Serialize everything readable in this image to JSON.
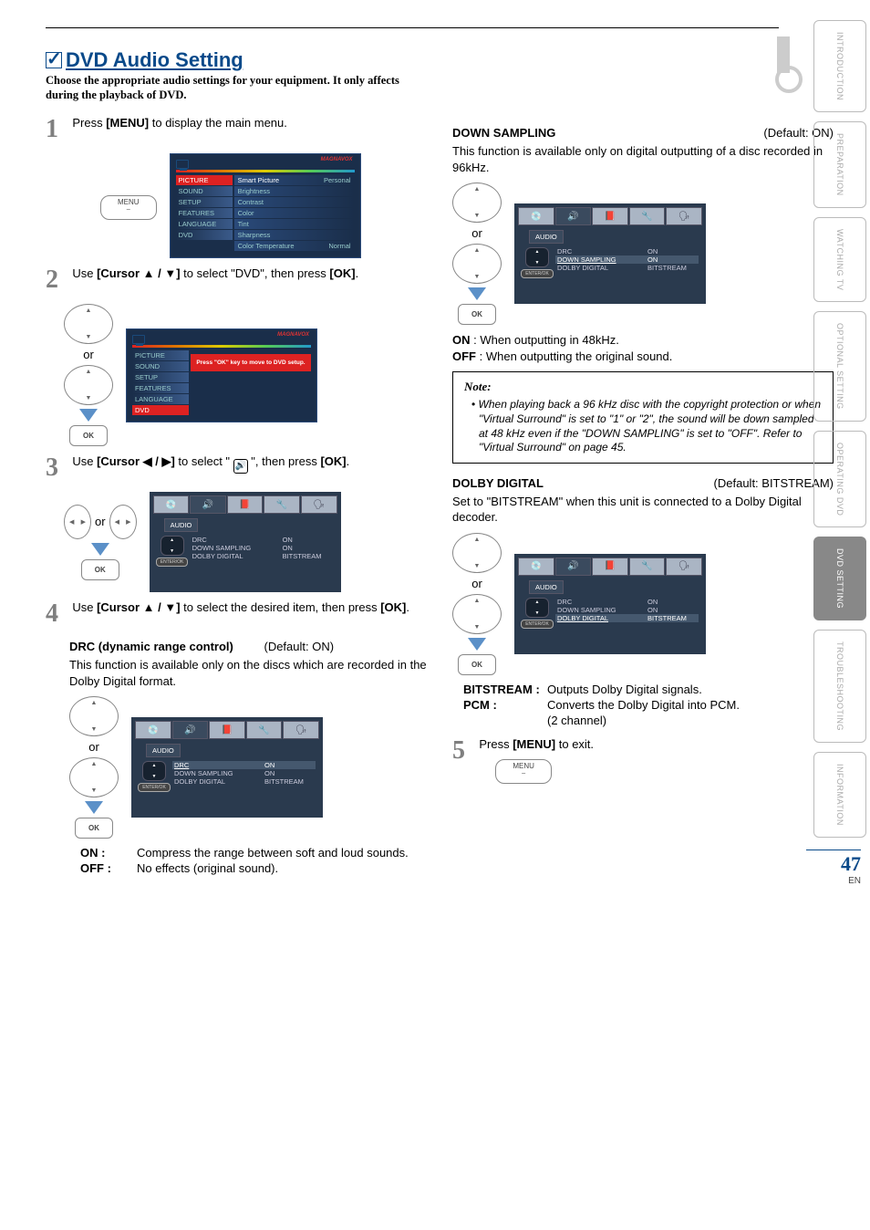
{
  "page_number": "47",
  "page_lang": "EN",
  "title": "DVD Audio Setting",
  "subtitle": "Choose the appropriate audio settings for your equipment. It only affects during the playback of DVD.",
  "sidetabs": [
    "INTRODUCTION",
    "PREPARATION",
    "WATCHING  TV",
    "OPTIONAL  SETTING",
    "OPERATING  DVD",
    "DVD  SETTING",
    "TROUBLESHOOTING",
    "INFORMATION"
  ],
  "active_sidetab": 5,
  "labels": {
    "menu": "MENU",
    "ok": "OK",
    "enter_ok": "ENTER/OK",
    "or": "or",
    "audio_label": "AUDIO",
    "brand": "MAGNAVOX"
  },
  "steps": {
    "s1": {
      "text_pre": "Press ",
      "key": "[MENU]",
      "text_post": " to display the main menu."
    },
    "s2": {
      "text_pre": "Use ",
      "key": "[Cursor ▲ / ▼]",
      "text_mid1": " to select \"DVD\", then press ",
      "key2": "[OK]",
      "text_end": "."
    },
    "s3": {
      "text_pre": "Use ",
      "key": "[Cursor ◀ / ▶]",
      "text_mid1": " to select \" ",
      "text_mid2": " \", then press ",
      "key2": "[OK]",
      "text_end": "."
    },
    "s4": {
      "text_pre": "Use ",
      "key": "[Cursor ▲ / ▼]",
      "text_mid1": " to select the desired item, then press ",
      "key2": "[OK]",
      "text_end": "."
    },
    "s5": {
      "text_pre": "Press ",
      "key": "[MENU]",
      "text_post": " to exit."
    }
  },
  "picture_menu": {
    "left": [
      "PICTURE",
      "SOUND",
      "SETUP",
      "FEATURES",
      "LANGUAGE",
      "DVD"
    ],
    "hl": 0,
    "right": [
      {
        "l": "Smart Picture",
        "v": "Personal"
      },
      {
        "l": "Brightness",
        "v": ""
      },
      {
        "l": "Contrast",
        "v": ""
      },
      {
        "l": "Color",
        "v": ""
      },
      {
        "l": "Tint",
        "v": ""
      },
      {
        "l": "Sharpness",
        "v": ""
      },
      {
        "l": "Color Temperature",
        "v": "Normal"
      }
    ]
  },
  "dvd_menu": {
    "left": [
      "PICTURE",
      "SOUND",
      "SETUP",
      "FEATURES",
      "LANGUAGE",
      "DVD"
    ],
    "hl": 5,
    "hint": "Press \"OK\" key to move to DVD setup."
  },
  "audio_osd": {
    "rows": [
      {
        "l": "DRC",
        "v": "ON"
      },
      {
        "l": "DOWN SAMPLING",
        "v": "ON"
      },
      {
        "l": "DOLBY DIGITAL",
        "v": "BITSTREAM"
      }
    ]
  },
  "drc": {
    "heading": "DRC (dynamic range control)",
    "default": "(Default: ON)",
    "desc": "This function is available only on the discs which are recorded in the Dolby Digital format.",
    "on_label": "ON :",
    "on_text": "Compress the range between soft and loud sounds.",
    "off_label": "OFF :",
    "off_text": "No effects (original sound).",
    "hl_row": 0
  },
  "down": {
    "heading": "DOWN SAMPLING",
    "default": "(Default: ON)",
    "desc": "This function is available only on digital outputting of a disc recorded in 96kHz.",
    "on_label": "ON",
    "on_text": ": When outputting in 48kHz.",
    "off_label": "OFF",
    "off_text": ": When outputting the original sound.",
    "hl_row": 1
  },
  "note": {
    "heading": "Note:",
    "body": "When playing back a 96 kHz disc with the copyright protection or when \"Virtual Surround\" is set to \"1\" or \"2\", the sound will be down sampled at 48 kHz even if the \"DOWN SAMPLING\" is set to \"OFF\".  Refer to \"Virtual Surround\" on page 45."
  },
  "dolby": {
    "heading": "DOLBY DIGITAL",
    "default": "(Default: BITSTREAM)",
    "desc": "Set to \"BITSTREAM\" when this unit is connected to a Dolby Digital decoder.",
    "bit_label": "BITSTREAM :",
    "bit_text": "Outputs Dolby Digital signals.",
    "pcm_label": "PCM :",
    "pcm_text1": "Converts the Dolby Digital into PCM.",
    "pcm_text2": "(2 channel)",
    "hl_row": 2
  }
}
